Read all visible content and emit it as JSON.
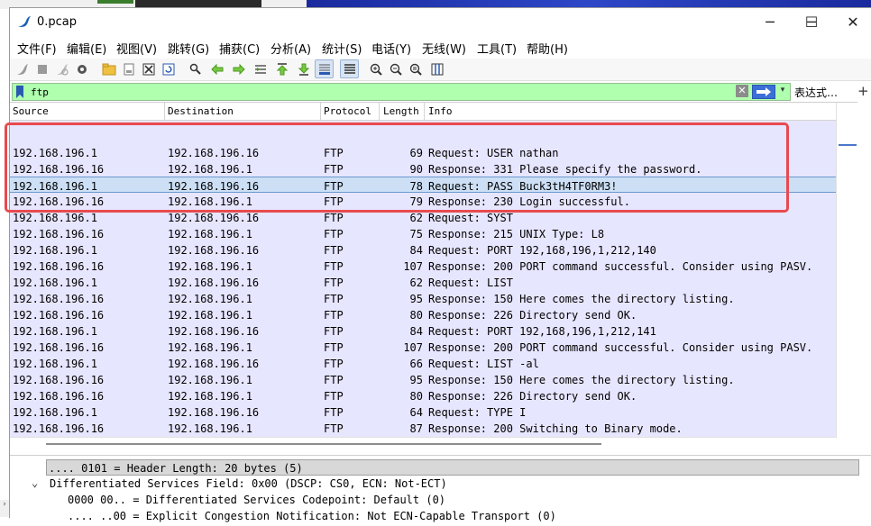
{
  "window": {
    "title": "0.pcap",
    "minimize": "─",
    "maximize": "☐",
    "close": "✕"
  },
  "menu": [
    "文件(F)",
    "编辑(E)",
    "视图(V)",
    "跳转(G)",
    "捕获(C)",
    "分析(A)",
    "统计(S)",
    "电话(Y)",
    "无线(W)",
    "工具(T)",
    "帮助(H)"
  ],
  "toolbar": {
    "icons": [
      "shark-fin-start-icon",
      "stop-icon",
      "restart-icon",
      "options-gear-icon",
      "open-folder-icon",
      "file-save-icon",
      "close-file-icon",
      "reload-icon",
      "find-icon",
      "go-back-icon",
      "go-forward-icon",
      "go-to-packet-icon",
      "first-packet-icon",
      "last-packet-icon",
      "autoscroll-icon",
      "colorize-icon",
      "zoom-in-icon",
      "zoom-out-icon",
      "zoom-reset-icon",
      "resize-columns-icon"
    ]
  },
  "filter": {
    "value": "ftp",
    "expression_label": "表达式…",
    "add_label": "+"
  },
  "columns": {
    "source": "Source",
    "destination": "Destination",
    "protocol": "Protocol",
    "length": "Length",
    "info": "Info"
  },
  "packets": [
    {
      "src": "192.168.196.1",
      "dst": "192.168.196.16",
      "proto": "FTP",
      "len": "69",
      "info": "Request: USER nathan"
    },
    {
      "src": "192.168.196.16",
      "dst": "192.168.196.1",
      "proto": "FTP",
      "len": "90",
      "info": "Response: 331 Please specify the password."
    },
    {
      "src": "192.168.196.1",
      "dst": "192.168.196.16",
      "proto": "FTP",
      "len": "78",
      "info": "Request: PASS Buck3tH4TF0RM3!"
    },
    {
      "src": "192.168.196.16",
      "dst": "192.168.196.1",
      "proto": "FTP",
      "len": "79",
      "info": "Response: 230 Login successful."
    },
    {
      "src": "192.168.196.1",
      "dst": "192.168.196.16",
      "proto": "FTP",
      "len": "62",
      "info": "Request: SYST"
    },
    {
      "src": "192.168.196.16",
      "dst": "192.168.196.1",
      "proto": "FTP",
      "len": "75",
      "info": "Response: 215 UNIX Type: L8"
    },
    {
      "src": "192.168.196.1",
      "dst": "192.168.196.16",
      "proto": "FTP",
      "len": "84",
      "info": "Request: PORT 192,168,196,1,212,140"
    },
    {
      "src": "192.168.196.16",
      "dst": "192.168.196.1",
      "proto": "FTP",
      "len": "107",
      "info": "Response: 200 PORT command successful. Consider using PASV."
    },
    {
      "src": "192.168.196.1",
      "dst": "192.168.196.16",
      "proto": "FTP",
      "len": "62",
      "info": "Request: LIST"
    },
    {
      "src": "192.168.196.16",
      "dst": "192.168.196.1",
      "proto": "FTP",
      "len": "95",
      "info": "Response: 150 Here comes the directory listing."
    },
    {
      "src": "192.168.196.16",
      "dst": "192.168.196.1",
      "proto": "FTP",
      "len": "80",
      "info": "Response: 226 Directory send OK."
    },
    {
      "src": "192.168.196.1",
      "dst": "192.168.196.16",
      "proto": "FTP",
      "len": "84",
      "info": "Request: PORT 192,168,196,1,212,141"
    },
    {
      "src": "192.168.196.16",
      "dst": "192.168.196.1",
      "proto": "FTP",
      "len": "107",
      "info": "Response: 200 PORT command successful. Consider using PASV."
    },
    {
      "src": "192.168.196.1",
      "dst": "192.168.196.16",
      "proto": "FTP",
      "len": "66",
      "info": "Request: LIST -al"
    },
    {
      "src": "192.168.196.16",
      "dst": "192.168.196.1",
      "proto": "FTP",
      "len": "95",
      "info": "Response: 150 Here comes the directory listing."
    },
    {
      "src": "192.168.196.16",
      "dst": "192.168.196.1",
      "proto": "FTP",
      "len": "80",
      "info": "Response: 226 Directory send OK."
    },
    {
      "src": "192.168.196.1",
      "dst": "192.168.196.16",
      "proto": "FTP",
      "len": "64",
      "info": "Request: TYPE I"
    },
    {
      "src": "192.168.196.16",
      "dst": "192.168.196.1",
      "proto": "FTP",
      "len": "87",
      "info": "Response: 200 Switching to Binary mode."
    }
  ],
  "selected_packet_index": 2,
  "details": {
    "header_length": ".... 0101 = Header Length: 20 bytes (5)",
    "dsfield": "Differentiated Services Field: 0x00 (DSCP: CS0, ECN: Not-ECT)",
    "dscp": "0000 00.. = Differentiated Services Codepoint: Default (0)",
    "ecn": ".... ..00 = Explicit Congestion Notification: Not ECN-Capable Transport (0)",
    "expander": "⌄"
  },
  "colors": {
    "row_bg": "#e7e6ff",
    "selected_bg": "#ccdff5",
    "filter_bg": "#afffaf",
    "highlight": "#e84a4f"
  }
}
